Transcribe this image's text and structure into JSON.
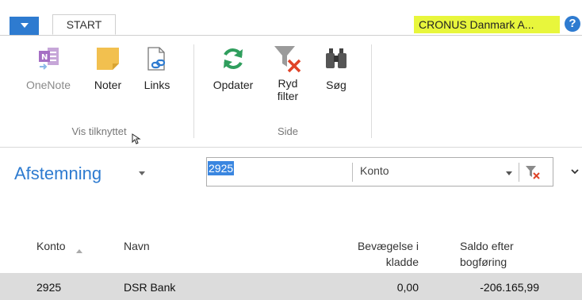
{
  "tabs": {
    "start": "START"
  },
  "company": "CRONUS Danmark A...",
  "help_symbol": "?",
  "ribbon": {
    "groups": [
      {
        "label": "Vis tilknyttet"
      },
      {
        "label": "Side"
      }
    ],
    "buttons": {
      "onenote": "OneNote",
      "noter": "Noter",
      "links": "Links",
      "opdater": "Opdater",
      "ryd_line1": "Ryd",
      "ryd_line2": "filter",
      "sog": "Søg"
    }
  },
  "page": {
    "title": "Afstemning",
    "search_value": "2925",
    "filter_field": "Konto"
  },
  "table": {
    "headers": {
      "konto": "Konto",
      "navn": "Navn",
      "bevaegelse_l1": "Bevægelse i",
      "bevaegelse_l2": "kladde",
      "saldo_l1": "Saldo efter",
      "saldo_l2": "bogføring"
    },
    "rows": [
      {
        "konto": "2925",
        "navn": "DSR Bank",
        "bevaegelse": "0,00",
        "saldo": "-206.165,99"
      }
    ]
  }
}
